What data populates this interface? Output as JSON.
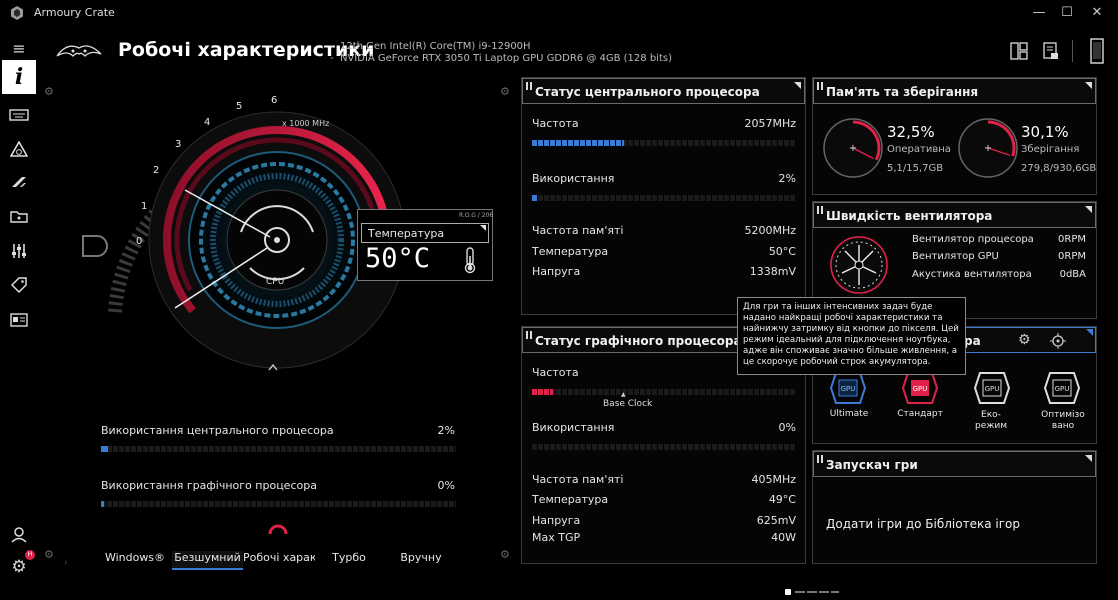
{
  "app": {
    "title": "Armoury Crate"
  },
  "window": {
    "minimize": "—",
    "maximize": "☐",
    "close": "✕"
  },
  "header": {
    "title": "Робочі характеристики",
    "cpu": "12th Gen Intel(R) Core(TM) i9-12900H",
    "gpu": "NVIDIA GeForce RTX 3050 Ti Laptop GPU GDDR6 @ 4GB (128 bits)"
  },
  "gauge": {
    "unit": "x 1000 MHz",
    "ticks": [
      "0",
      "1",
      "2",
      "3",
      "4",
      "5",
      "6"
    ],
    "center_label": "CPU",
    "temp_tag": "R.O.G / 206",
    "temp_label": "Температура",
    "temp_value": "50°C"
  },
  "usage": {
    "cpu_label": "Використання центрального процесора",
    "cpu_value": "2%",
    "cpu_pct": 2,
    "gpu_label": "Використання графічного процесора",
    "gpu_value": "0%",
    "gpu_pct": 0
  },
  "modes": {
    "items": [
      "Windows®",
      "Безшумний",
      "Робочі характе",
      "Турбо",
      "Вручну"
    ],
    "active_index": 1
  },
  "cpu_status": {
    "title": "Статус центрального процесора",
    "freq_label": "Частота",
    "freq_value": "2057MHz",
    "freq_pct": 35,
    "usage_label": "Використання",
    "usage_value": "2%",
    "usage_pct": 2,
    "mem_freq_label": "Частота пам'яті",
    "mem_freq_value": "5200MHz",
    "temp_label": "Температура",
    "temp_value": "50°C",
    "volt_label": "Напруга",
    "volt_value": "1338mV"
  },
  "gpu_status": {
    "title": "Статус графічного процесора",
    "freq_label": "Частота",
    "freq_pct": 8,
    "base_clock": "Base Clock",
    "usage_label": "Використання",
    "usage_value": "0%",
    "mem_freq_label": "Частота пам'яті",
    "mem_freq_value": "405MHz",
    "temp_label": "Температура",
    "temp_value": "49°C",
    "volt_label": "Напруга",
    "volt_value": "625mV",
    "tgp_label": "Max TGP",
    "tgp_value": "40W"
  },
  "memory": {
    "title": "Пам'ять та зберігання",
    "ram_pct": "32,5%",
    "ram_label": "Оперативна п",
    "ram_value": "5,1/15,7GB",
    "ram_fraction": 0.325,
    "storage_pct": "30,1%",
    "storage_label": "Зберігання",
    "storage_value": "279,8/930,6GB",
    "storage_fraction": 0.301
  },
  "fan": {
    "title": "Швидкість вентилятора",
    "cpu_label": "Вентилятор процесора",
    "cpu_value": "0RPM",
    "gpu_label": "Вентилятор GPU",
    "gpu_value": "0RPM",
    "noise_label": "Акустика вентилятора",
    "noise_value": "0dBA"
  },
  "gpu_mode": {
    "title_tail": "ра",
    "items": [
      "Ultimate",
      "Стандарт",
      "Еко-\nрежим",
      "Оптимізо\nвано"
    ],
    "active_index": 1,
    "chip_text": "GPU"
  },
  "game_launcher": {
    "title": "Запускач гри",
    "add_text": "Додати ігри до Бібліотека ігор"
  },
  "tooltip": {
    "text": "Для гри та інших інтенсивних задач буде надано найкращі робочі характеристики та найнижчу затримку від кнопки до пікселя. Цей режим ідеальний для підключення ноутбука, адже він споживає значно більше живлення, а це скорочує робочий строк акумулятора."
  },
  "notifications": {
    "badge": "H"
  },
  "colors": {
    "accent_red": "#e0224a",
    "accent_blue": "#3a7bd5",
    "panel_border": "#6a6a6a"
  }
}
